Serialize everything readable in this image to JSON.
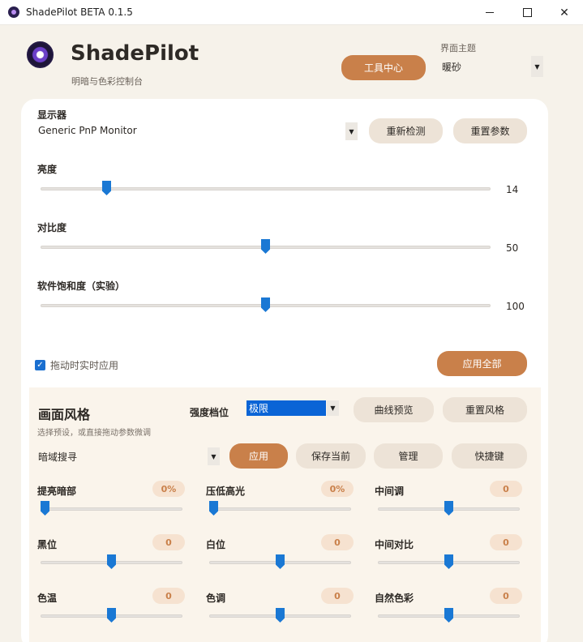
{
  "window": {
    "title": "ShadePilot BETA 0.1.5"
  },
  "header": {
    "brand": "ShadePilot",
    "subtitle": "明暗与色彩控制台",
    "tools_button": "工具中心",
    "theme_label": "界面主题",
    "theme_value": "暖砂"
  },
  "display": {
    "label": "显示器",
    "monitor": "Generic PnP Monitor",
    "redetect_button": "重新检测",
    "reset_params_button": "重置参数",
    "sliders": [
      {
        "label": "亮度",
        "value": "14",
        "fraction": 0.14
      },
      {
        "label": "对比度",
        "value": "50",
        "fraction": 0.5
      },
      {
        "label": "软件饱和度（实验）",
        "value": "100",
        "fraction": 0.5
      }
    ],
    "live_apply_label": "拖动时实时应用",
    "apply_all_button": "应用全部"
  },
  "style": {
    "title": "画面风格",
    "subtitle": "选择预设，或直接拖动参数微调",
    "strength_label": "强度档位",
    "strength_value": "极限",
    "curve_preview_button": "曲线预览",
    "reset_style_button": "重置风格",
    "preset_value": "暗域搜寻",
    "apply_button": "应用",
    "save_button": "保存当前",
    "manage_button": "管理",
    "hotkey_button": "快捷键",
    "params": [
      {
        "label": "提亮暗部",
        "value": "0%",
        "fraction": 0.0
      },
      {
        "label": "压低高光",
        "value": "0%",
        "fraction": 0.0
      },
      {
        "label": "中间调",
        "value": "0",
        "fraction": 0.5
      },
      {
        "label": "黑位",
        "value": "0",
        "fraction": 0.5
      },
      {
        "label": "白位",
        "value": "0",
        "fraction": 0.5
      },
      {
        "label": "中间对比",
        "value": "0",
        "fraction": 0.5
      },
      {
        "label": "色温",
        "value": "0",
        "fraction": 0.5
      },
      {
        "label": "色调",
        "value": "0",
        "fraction": 0.5
      },
      {
        "label": "自然色彩",
        "value": "0",
        "fraction": 0.5
      }
    ]
  }
}
